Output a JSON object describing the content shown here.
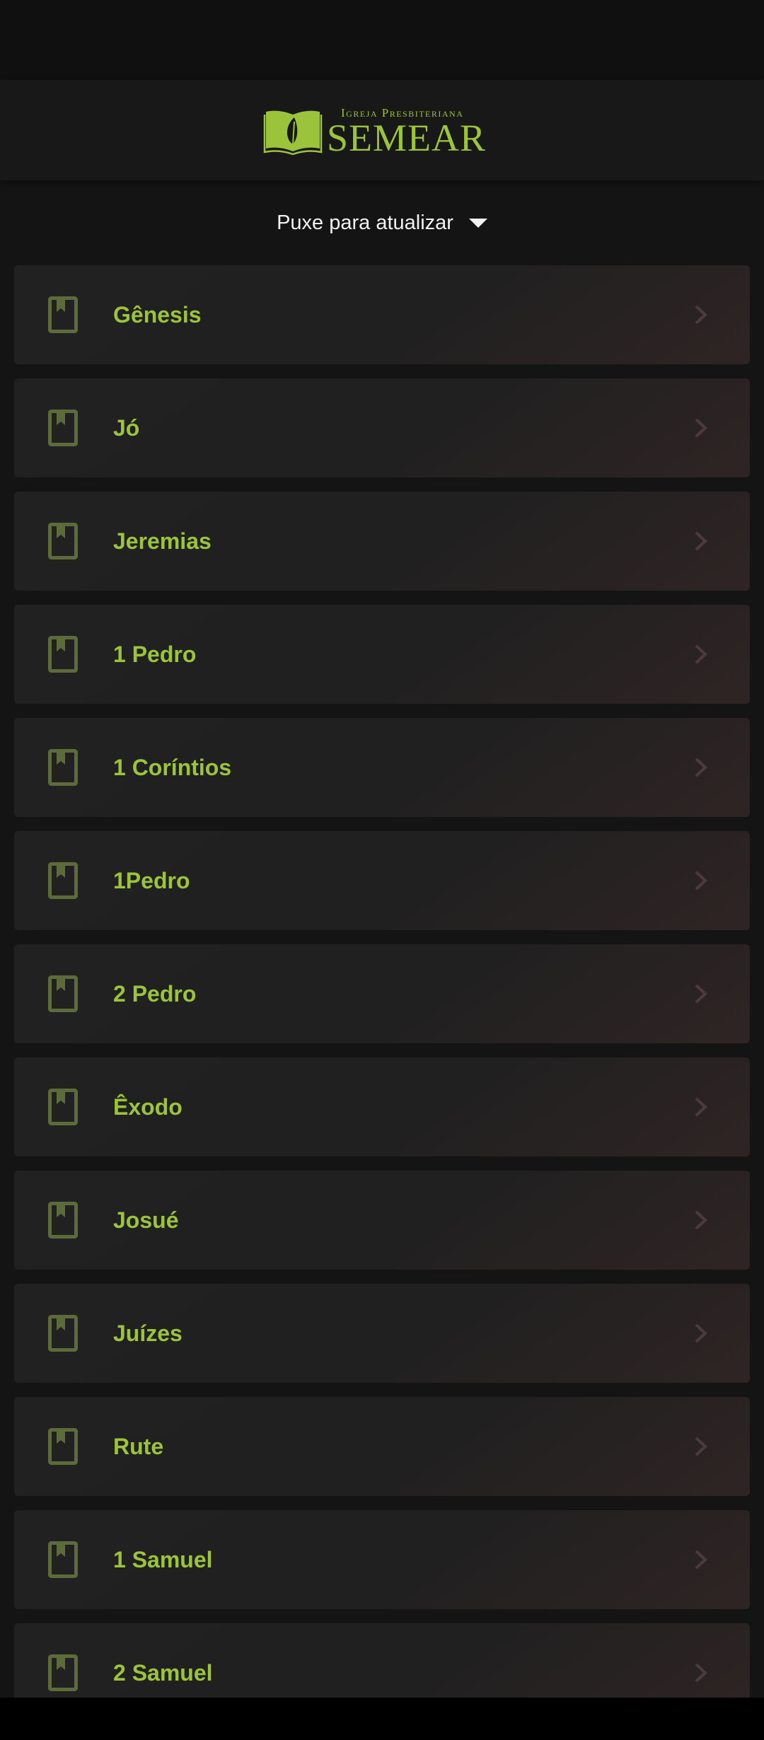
{
  "header": {
    "logo_subtitle": "Igreja Presbiteriana",
    "logo_title": "SEMEAR"
  },
  "refresh": {
    "label": "Puxe para atualizar"
  },
  "colors": {
    "accent": "#9cc43a",
    "icon_muted": "#5d6a3a",
    "chevron": "#4e3a3c",
    "background": "#141414"
  },
  "icons": {
    "book": "bookmark-book-icon",
    "chevron": "chevron-right-icon",
    "caret": "caret-down-icon"
  },
  "books": [
    {
      "label": "Gênesis"
    },
    {
      "label": "Jó"
    },
    {
      "label": "Jeremias"
    },
    {
      "label": "1 Pedro"
    },
    {
      "label": "1 Coríntios"
    },
    {
      "label": "1Pedro"
    },
    {
      "label": "2 Pedro"
    },
    {
      "label": "Êxodo"
    },
    {
      "label": "Josué"
    },
    {
      "label": "Juízes"
    },
    {
      "label": "Rute"
    },
    {
      "label": "1 Samuel"
    },
    {
      "label": "2 Samuel"
    }
  ]
}
